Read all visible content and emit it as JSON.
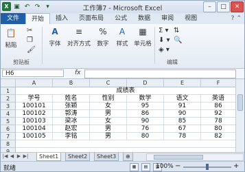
{
  "window": {
    "title": "工作簿7 - Microsoft Excel"
  },
  "qat": {
    "logo": "X",
    "icons": [
      "save-icon",
      "undo-icon",
      "redo-icon",
      "dropdown-icon"
    ]
  },
  "window_controls": {
    "minimize": "–",
    "maximize": "□",
    "close": "✕"
  },
  "ribbon": {
    "tabs": [
      "文件",
      "开始",
      "插入",
      "页面布局",
      "公式",
      "数据",
      "审阅",
      "视图"
    ],
    "active_tab": "开始",
    "groups": {
      "clipboard": {
        "paste_label": "粘贴",
        "group_label": "剪贴板"
      },
      "font": {
        "label": "字体"
      },
      "alignment": {
        "label": "对齐方式"
      },
      "number": {
        "label": "数字"
      },
      "styles": {
        "label": "样式"
      },
      "cells": {
        "label": "单元格"
      },
      "editing": {
        "group_label": "编辑"
      }
    }
  },
  "formula_bar": {
    "name_box": "H6",
    "fx": "fx",
    "value": ""
  },
  "sheet": {
    "columns": [
      "A",
      "B",
      "C",
      "D",
      "E",
      "F"
    ],
    "rows": [
      "1",
      "2",
      "3",
      "4",
      "5",
      "6",
      "7",
      "8",
      "9"
    ],
    "title": "成绩表",
    "headers": [
      "学号",
      "姓名",
      "性别",
      "数学",
      "语文",
      "英语"
    ],
    "data": [
      [
        "100101",
        "张颖",
        "女",
        "95",
        "91",
        "86"
      ],
      [
        "100102",
        "郭涛",
        "男",
        "86",
        "90",
        "92"
      ],
      [
        "100103",
        "梁冰",
        "女",
        "90",
        "85",
        "78"
      ],
      [
        "100104",
        "赵宏",
        "男",
        "76",
        "67",
        "80"
      ],
      [
        "100105",
        "李铭",
        "男",
        "80",
        "78",
        "82"
      ]
    ]
  },
  "sheet_tabs": [
    "Sheet1",
    "Sheet2",
    "Sheet3"
  ],
  "active_sheet": "Sheet1",
  "status_bar": {
    "ready": "就绪",
    "zoom": "100%",
    "zoom_minus": "−",
    "zoom_plus": "+"
  }
}
